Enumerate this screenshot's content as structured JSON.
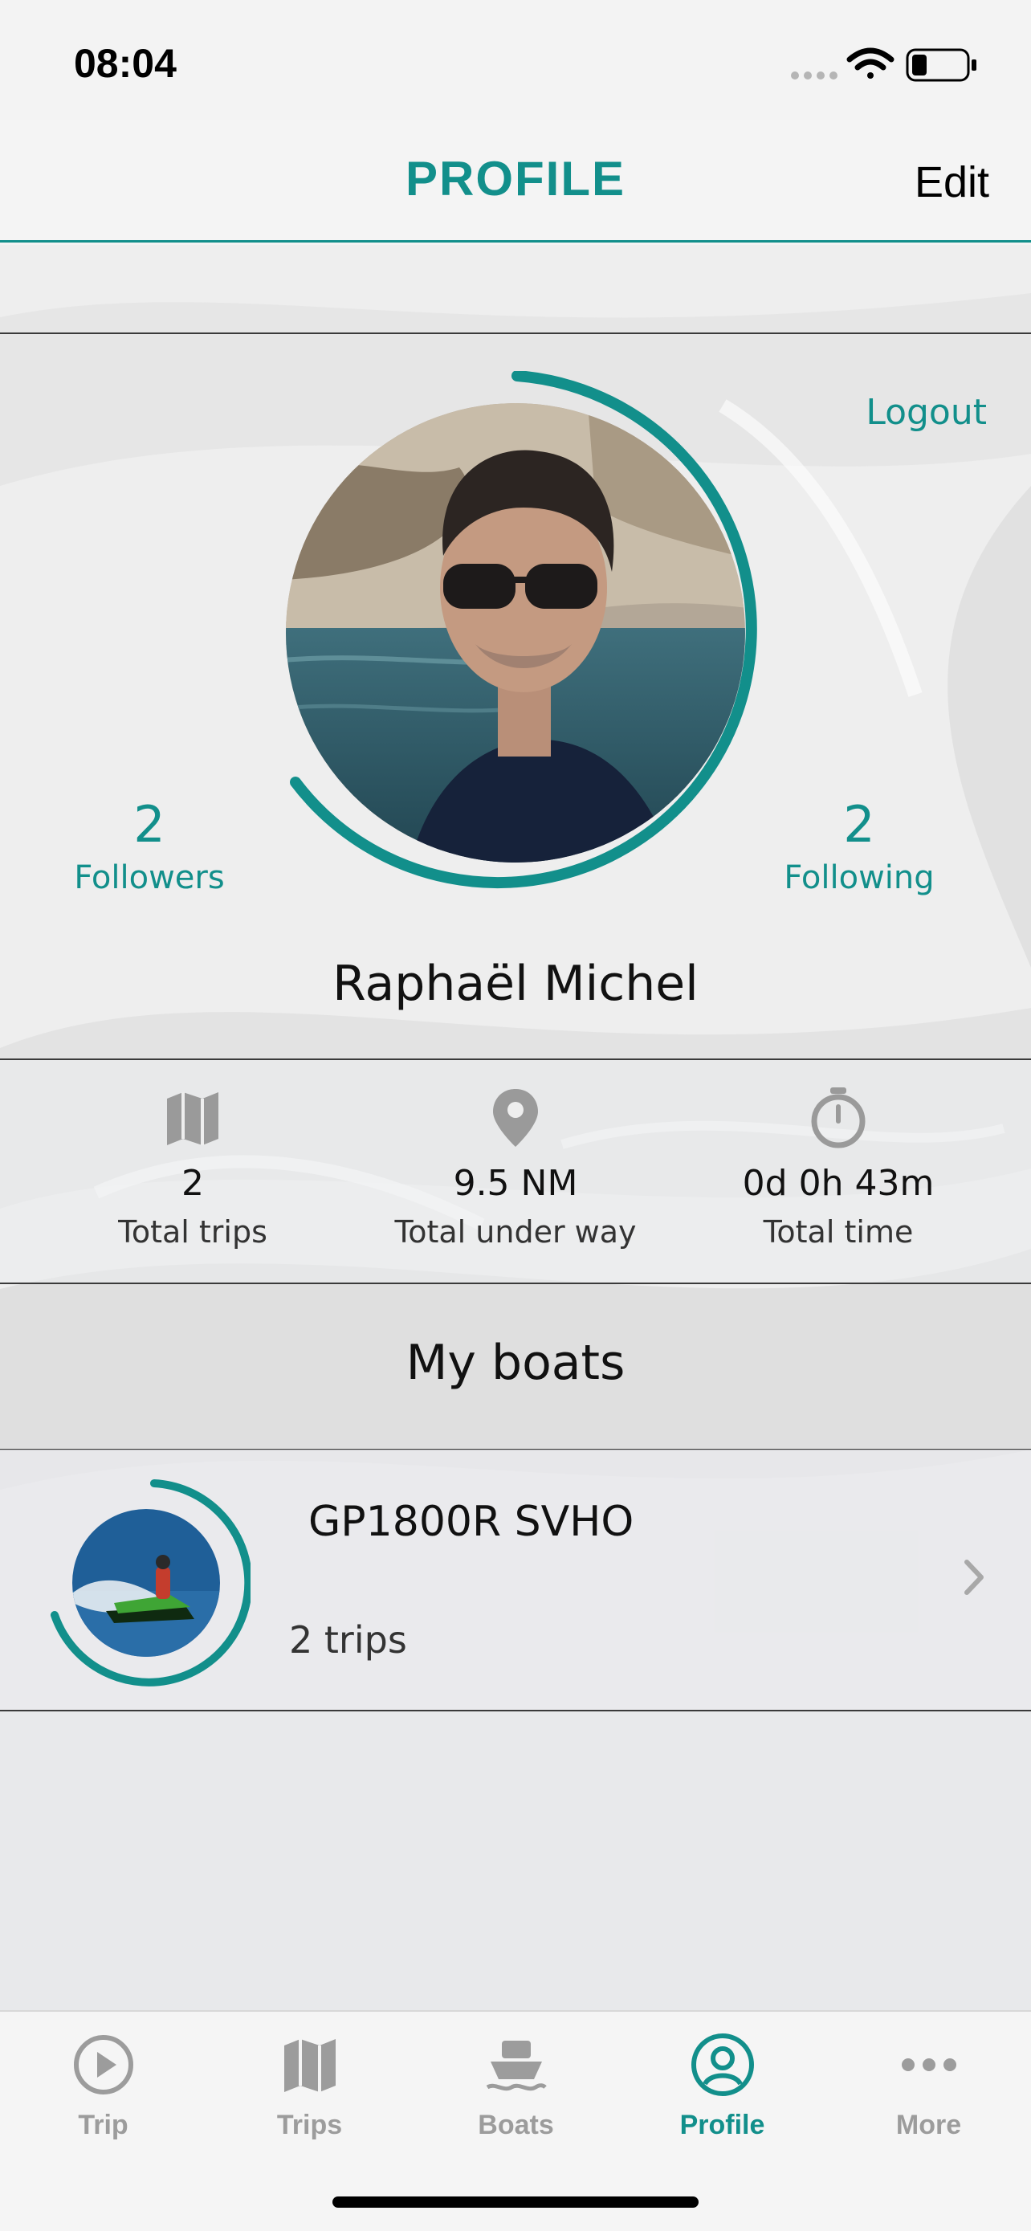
{
  "status_bar": {
    "time": "08:04"
  },
  "nav": {
    "title": "PROFILE",
    "edit_label": "Edit"
  },
  "profile": {
    "logout_label": "Logout",
    "followers_count": "2",
    "followers_label": "Followers",
    "following_count": "2",
    "following_label": "Following",
    "name": "Raphaël Michel",
    "progress_ring_fraction": 0.8
  },
  "totals": [
    {
      "icon": "map-icon",
      "value": "2",
      "label": "Total trips"
    },
    {
      "icon": "location-pin-icon",
      "value": "9.5 NM",
      "label": "Total under way"
    },
    {
      "icon": "stopwatch-icon",
      "value": "0d 0h 43m",
      "label": "Total time"
    }
  ],
  "boats_section": {
    "title": "My boats"
  },
  "boats": [
    {
      "name": "GP1800R SVHO",
      "trips": "2 trips",
      "progress_ring_fraction": 0.8
    }
  ],
  "tabs": [
    {
      "icon": "play-icon",
      "label": "Trip",
      "active": false
    },
    {
      "icon": "map-icon",
      "label": "Trips",
      "active": false
    },
    {
      "icon": "boat-icon",
      "label": "Boats",
      "active": false
    },
    {
      "icon": "profile-icon",
      "label": "Profile",
      "active": true
    },
    {
      "icon": "more-icon",
      "label": "More",
      "active": false
    }
  ],
  "colors": {
    "accent": "#128f8b",
    "inactive_tab": "#9c9c9c",
    "icon_gray": "#9a9a9a"
  }
}
